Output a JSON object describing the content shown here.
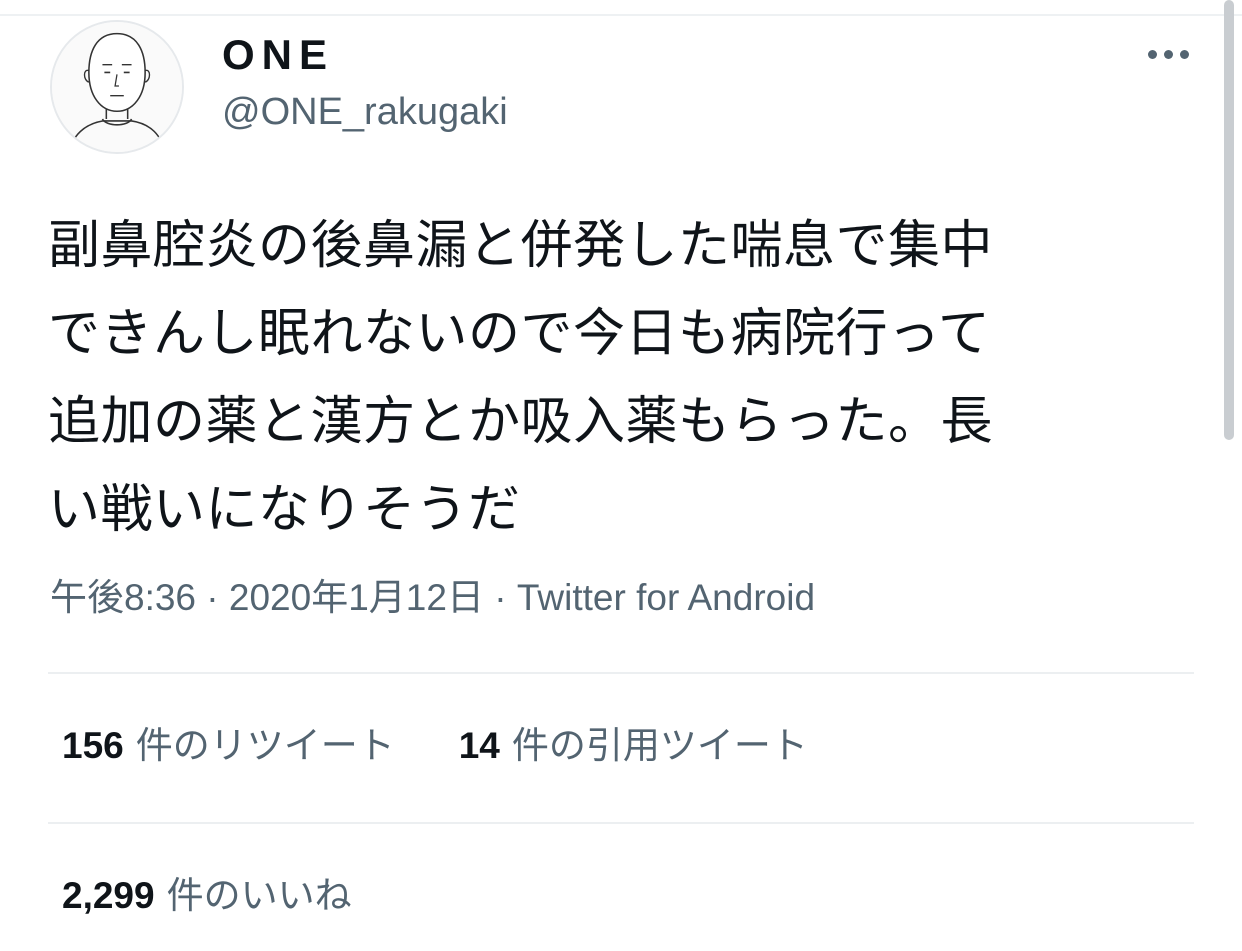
{
  "author": {
    "display_name": "ONE",
    "handle": "@ONE_rakugaki",
    "avatar": "line-drawing-face-avatar"
  },
  "tweet": {
    "lines": [
      "副鼻腔炎の後鼻漏と併発した喘息で集中",
      "できんし眠れないので今日も病院行って",
      "追加の薬と漢方とか吸入薬もらった。長",
      "い戦いになりそうだ"
    ]
  },
  "meta": {
    "time": "午後8:36",
    "separator": " · ",
    "date": "2020年1月12日",
    "source": "Twitter for Android"
  },
  "stats": {
    "retweets_count": "156",
    "retweets_label": "件のリツイート",
    "quotes_count": "14",
    "quotes_label": "件の引用ツイート",
    "likes_count": "2,299",
    "likes_label": "件のいいね"
  },
  "icons": {
    "more": "more-horizontal-icon"
  },
  "colors": {
    "primary_text": "#0f1419",
    "secondary_text": "#536471",
    "divider": "#eceff1"
  }
}
